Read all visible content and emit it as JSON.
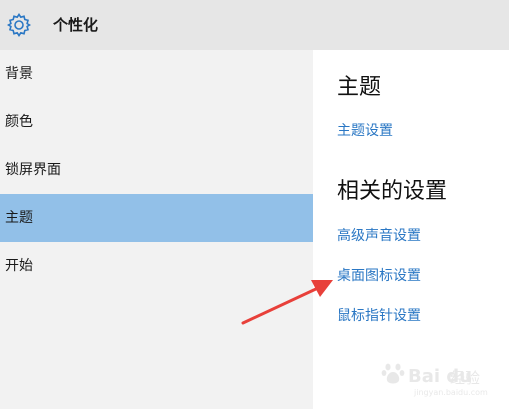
{
  "header": {
    "title": "个性化",
    "icon": "gear-icon"
  },
  "sidebar": {
    "items": [
      {
        "label": "背景",
        "selected": false
      },
      {
        "label": "颜色",
        "selected": false
      },
      {
        "label": "锁屏界面",
        "selected": false
      },
      {
        "label": "主题",
        "selected": true
      },
      {
        "label": "开始",
        "selected": false
      }
    ]
  },
  "main": {
    "theme_section_title": "主题",
    "theme_settings_link": "主题设置",
    "related_section_title": "相关的设置",
    "related_links": [
      "高级声音设置",
      "桌面图标设置",
      "鼠标指针设置"
    ]
  },
  "watermark": {
    "brand": "Bai du",
    "suffix": "经验",
    "url": "jingyan.baidu.com"
  },
  "colors": {
    "accent": "#2a77c4",
    "selected_bg": "#92c0e8",
    "arrow": "#e8403a"
  }
}
